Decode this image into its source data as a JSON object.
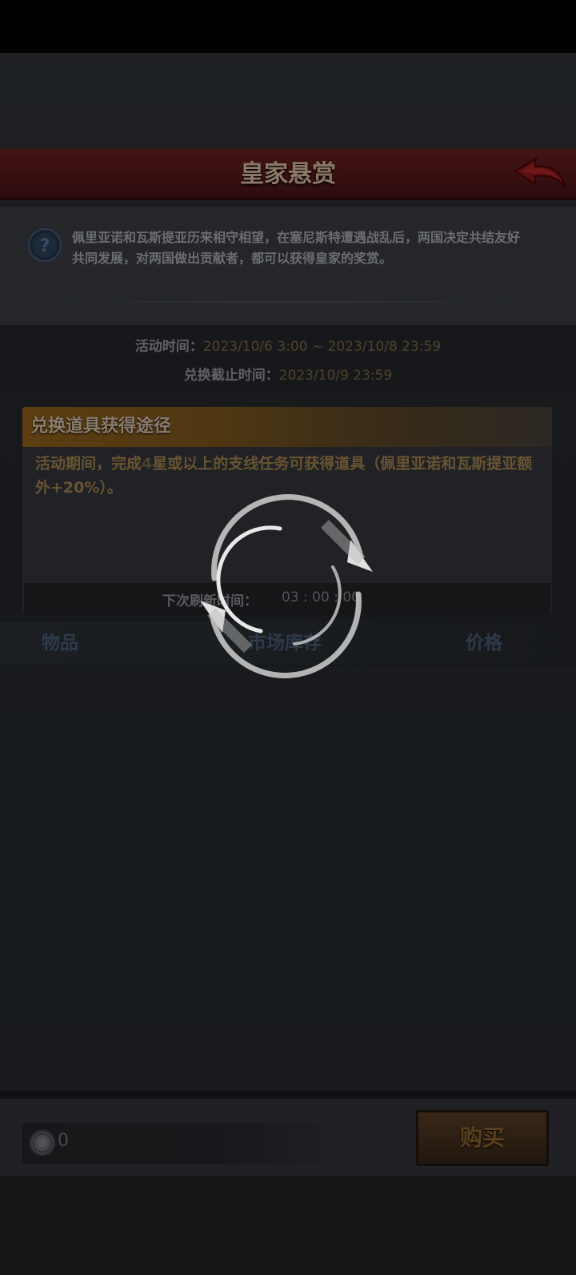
{
  "header": {
    "title": "皇家悬赏"
  },
  "info": {
    "description": "佩里亚诺和瓦斯提亚历来相守相望，在塞尼斯特遭遇战乱后，两国决定共结友好共同发展，对两国做出贡献者，都可以获得皇家的奖赏。"
  },
  "time": {
    "activity_label": "活动时间：",
    "activity_value": "2023/10/6 3:00 ~ 2023/10/8 23:59",
    "deadline_label": "兑换截止时间：",
    "deadline_value": "2023/10/9 23:59"
  },
  "acquisition": {
    "title": "兑换道具获得途径",
    "text_part1": "活动期间，完成",
    "text_highlight": "4",
    "text_part2": "星或以上的支线任务可获得道具（佩里亚诺和瓦斯提亚额外+20%）。"
  },
  "refresh": {
    "label": "下次刷新时间：",
    "value": "03 : 00 : 00"
  },
  "columns": {
    "item": "物品",
    "stock": "市场库存",
    "price": "价格"
  },
  "footer": {
    "currency_value": "0",
    "buy_label": "购买"
  },
  "icons": {
    "back": "back-arrow-icon",
    "help": "question-mark-icon",
    "coin": "coin-icon",
    "loading": "loading-spinner-icon"
  },
  "colors": {
    "header_red": "#4a1517",
    "accent_gold": "#7b5317",
    "value_gold": "#6c5a35",
    "column_blue": "#3c4e63"
  }
}
